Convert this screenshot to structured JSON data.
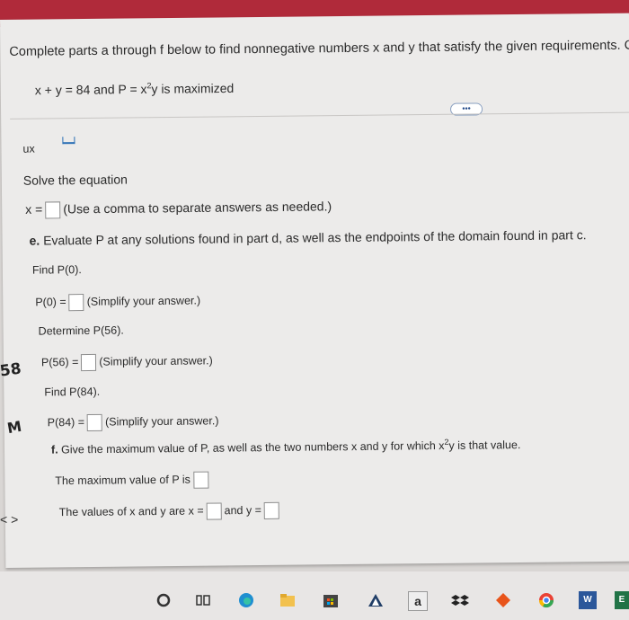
{
  "header": {
    "instruction": "Complete parts a through f below to find nonnegative numbers x and y that satisfy the given requirements.",
    "instruction_tail": "G",
    "conditions": "x + y = 84 and P = x",
    "conditions_exp": "2",
    "conditions_end": "y is maximized",
    "more_button": "•••"
  },
  "part_d": {
    "partial_text": "ux",
    "solve_label": "Solve the equation",
    "x_label": "x =",
    "hint": "(Use a comma to separate answers as needed.)"
  },
  "part_e": {
    "title_prefix": "e.",
    "title": "Evaluate P at any solutions found in part d, as well as the endpoints of the domain found in part c.",
    "find0": "Find P(0).",
    "p0_label": "P(0) =",
    "simplify": "(Simplify your answer.)",
    "det56": "Determine P(56).",
    "p56_label": "P(56) =",
    "find84": "Find P(84).",
    "p84_label": "P(84) ="
  },
  "part_f": {
    "title_prefix": "f.",
    "title": "Give the maximum value of P, as well as the two numbers x and y for which x",
    "title_exp": "2",
    "title_end": "y is that value.",
    "max_label": "The maximum value of P is",
    "xy_label": "The values of x and y are x =",
    "and_y": "and y ="
  },
  "handwriting": {
    "mark1": "58",
    "mark2": "M"
  },
  "nav": {
    "arrow": "<  >"
  },
  "taskbar": {
    "icons": [
      "circle-icon",
      "task-view-icon",
      "edge-icon",
      "file-explorer-icon",
      "store-icon",
      "vpn-icon",
      "amazon-icon",
      "dropbox-icon",
      "diamond-icon",
      "chrome-icon",
      "word-icon",
      "excel-icon"
    ]
  },
  "colors": {
    "accent": "#b02a3a",
    "page_bg": "#ecebea",
    "button_border": "#8aa0c0"
  }
}
